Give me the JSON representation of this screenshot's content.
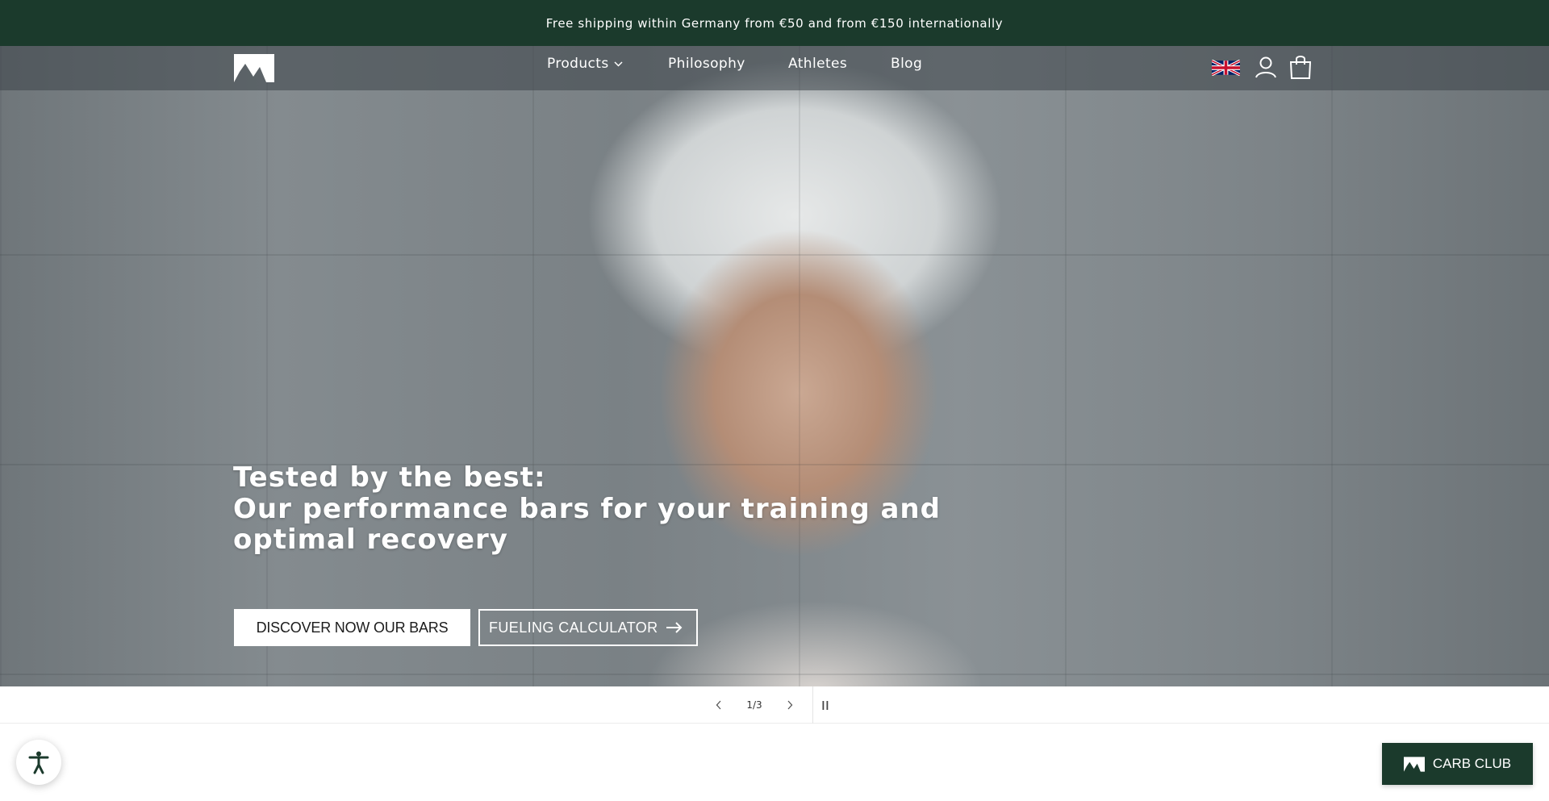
{
  "announcement": {
    "text": "Free shipping within Germany from €50 and from €150 internationally"
  },
  "header": {
    "logo_icon": "mountain-logo-icon",
    "nav": [
      {
        "label": "Products",
        "has_dropdown": true
      },
      {
        "label": "Philosophy"
      },
      {
        "label": "Athletes"
      },
      {
        "label": "Blog"
      }
    ],
    "icons": [
      "uk-flag-icon",
      "account-icon",
      "cart-icon"
    ]
  },
  "hero": {
    "headline": [
      "Tested by the best:",
      "Our performance bars for your training and",
      "optimal recovery"
    ],
    "primary_button": "DISCOVER NOW OUR BARS",
    "secondary_button": "FUELING CALCULATOR",
    "secondary_icon": "arrow-right-icon"
  },
  "slider": {
    "counter": "1/3",
    "prev_icon": "chevron-left-icon",
    "next_icon": "chevron-right-icon",
    "pause_icon": "pause-icon"
  },
  "accessibility": {
    "icon": "accessibility-icon"
  },
  "carb_club": {
    "label": "CARB CLUB",
    "icon": "mountain-logo-icon"
  },
  "colors": {
    "brand_green": "#1b3a2c",
    "white": "#ffffff"
  }
}
